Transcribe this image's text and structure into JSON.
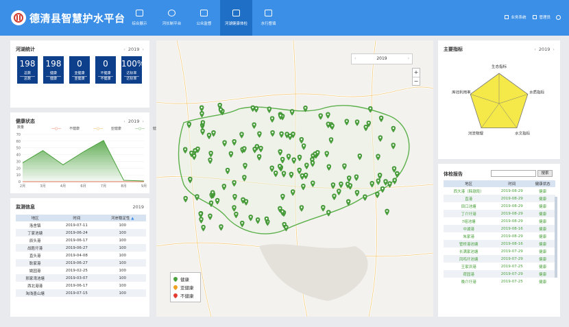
{
  "header": {
    "title": "德清县智慧护水平台",
    "nav": [
      {
        "label": "综合展示",
        "icon": "home-icon"
      },
      {
        "label": "河长制平台",
        "icon": "network-icon"
      },
      {
        "label": "公众监督",
        "icon": "monitor-icon"
      },
      {
        "label": "河湖健康体检",
        "icon": "report-icon"
      },
      {
        "label": "水行督填",
        "icon": "document-icon"
      }
    ],
    "active_nav": 3,
    "right": {
      "system": "业务系统",
      "admin": "管理员"
    }
  },
  "river_stats": {
    "title": "河湖统计",
    "year": "2019",
    "boxes": [
      {
        "value": "198",
        "top": "总数",
        "bottom": "总数"
      },
      {
        "value": "198",
        "top": "健康",
        "bottom": "健康"
      },
      {
        "value": "0",
        "top": "亚健康",
        "bottom": "亚健康"
      },
      {
        "value": "0",
        "top": "不健康",
        "bottom": "不健康"
      },
      {
        "value": "100%",
        "top": "达标率",
        "bottom": "达标率"
      }
    ]
  },
  "health_status": {
    "title": "健康状态",
    "year": "2019",
    "unit": "数量",
    "legend": [
      "不健康",
      "亚健康",
      "健康"
    ],
    "colors": {
      "unhealthy": "#e8572a",
      "subhealthy": "#f0a020",
      "healthy": "#49a03b"
    }
  },
  "chart_data": {
    "type": "area",
    "x": [
      "2月",
      "3月",
      "4月",
      "6月",
      "7月",
      "8月",
      "9月"
    ],
    "yticks": [
      0,
      10,
      20,
      30,
      40,
      50,
      60,
      70
    ],
    "ylim": [
      0,
      70
    ],
    "series": [
      {
        "name": "健康",
        "values": [
          28,
          46,
          25,
          44,
          61,
          2,
          1
        ]
      },
      {
        "name": "亚健康",
        "values": [
          0,
          0,
          0,
          0,
          0,
          0,
          0
        ]
      },
      {
        "name": "不健康",
        "values": [
          0,
          0,
          0,
          0,
          0,
          0,
          0
        ]
      }
    ]
  },
  "monitor": {
    "title": "监测信息",
    "year": "2019",
    "headers": [
      "地区",
      "时间",
      "河岸稳定性"
    ],
    "rows": [
      [
        "洛舍镇",
        "2019-07-11",
        "100"
      ],
      [
        "丁家池塘",
        "2019-06-24",
        "100"
      ],
      [
        "辰头港",
        "2019-06-17",
        "100"
      ],
      [
        "战胜圩港",
        "2019-06-27",
        "100"
      ],
      [
        "直头港",
        "2019-04-08",
        "100"
      ],
      [
        "耿家港",
        "2019-06-27",
        "100"
      ],
      [
        "姚园港",
        "2019-02-25",
        "100"
      ],
      [
        "邢家湾池塘",
        "2019-03-07",
        "100"
      ],
      [
        "西北港港",
        "2019-06-17",
        "100"
      ],
      [
        "淘浅墨山塘",
        "2019-07-15",
        "100"
      ]
    ]
  },
  "map": {
    "year": "2019",
    "legend": [
      "健康",
      "亚健康",
      "不健康"
    ],
    "zoom_in": "+",
    "zoom_out": "−"
  },
  "indicators": {
    "title": "主要指标",
    "year": "2019",
    "axes": [
      "生态指标",
      "水质指标",
      "水文指标",
      "河流物理",
      "库径利用率"
    ],
    "values": [
      1,
      1,
      1,
      1,
      1
    ],
    "fill": "#f5e94a"
  },
  "report": {
    "title": "体检报告",
    "search_btn": "搜索",
    "headers": [
      "地区",
      "时间",
      "健康状态"
    ],
    "rows": [
      [
        "西大港（韩墩段）",
        "2019-08-29",
        "健康"
      ],
      [
        "直港",
        "2019-08-29",
        "健康"
      ],
      [
        "田口池塘",
        "2019-08-29",
        "健康"
      ],
      [
        "丁介圩港",
        "2019-08-29",
        "健康"
      ],
      [
        "7组池塘",
        "2019-08-29",
        "健康"
      ],
      [
        "中湖港",
        "2019-08-16",
        "健康"
      ],
      [
        "朱家港",
        "2019-08-29",
        "健康"
      ],
      [
        "管桥港池塘",
        "2019-08-16",
        "健康"
      ],
      [
        "长满家池塘",
        "2019-07-29",
        "健康"
      ],
      [
        "凤鸣圩池塘",
        "2019-07-29",
        "健康"
      ],
      [
        "王家浜港",
        "2019-07-25",
        "健康"
      ],
      [
        "荷园港",
        "2019-07-29",
        "健康"
      ],
      [
        "晚介圩港",
        "2019-07-25",
        "健康"
      ]
    ]
  }
}
